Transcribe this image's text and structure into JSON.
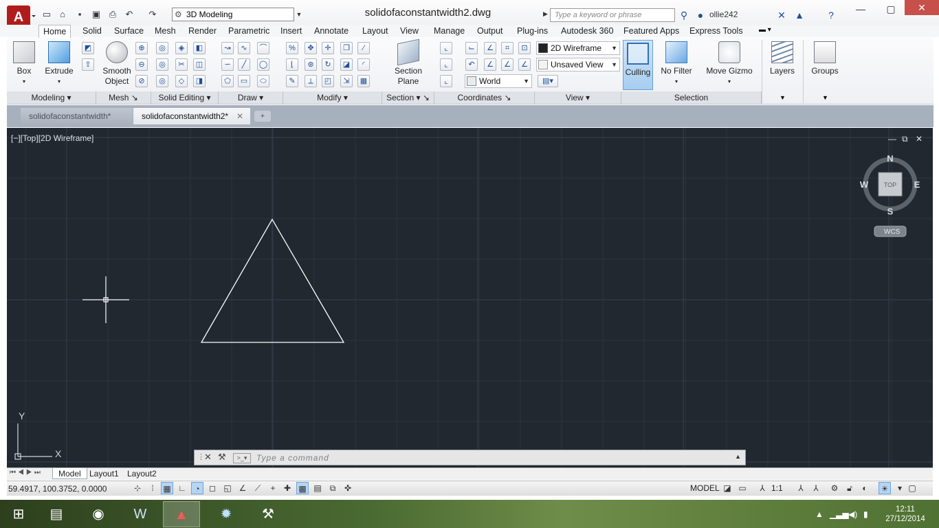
{
  "titlebar": {
    "workspace": "3D Modeling",
    "document_title": "solidofaconstantwidth2.dwg",
    "search_placeholder": "Type a keyword or phrase",
    "username": "ollie242"
  },
  "ribbon_tabs": [
    "Home",
    "Solid",
    "Surface",
    "Mesh",
    "Render",
    "Parametric",
    "Insert",
    "Annotate",
    "Layout",
    "View",
    "Manage",
    "Output",
    "Plug-ins",
    "Autodesk 360",
    "Featured Apps",
    "Express Tools"
  ],
  "active_tab": "Home",
  "panels": {
    "modeling": {
      "title": "Modeling",
      "box": "Box",
      "extrude": "Extrude"
    },
    "mesh": {
      "title": "Mesh",
      "smooth_object_1": "Smooth",
      "smooth_object_2": "Object"
    },
    "solid_editing": {
      "title": "Solid Editing"
    },
    "draw": {
      "title": "Draw"
    },
    "modify": {
      "title": "Modify"
    },
    "section": {
      "title": "Section",
      "section_plane_1": "Section",
      "section_plane_2": "Plane"
    },
    "coordinates": {
      "title": "Coordinates",
      "ucs": "World"
    },
    "view": {
      "title": "View",
      "visual_style": "2D Wireframe",
      "named_view": "Unsaved View"
    },
    "selection": {
      "title": "Selection",
      "culling": "Culling",
      "no_filter": "No Filter",
      "move_gizmo": "Move Gizmo"
    },
    "layers": {
      "label": "Layers"
    },
    "groups": {
      "label": "Groups"
    }
  },
  "doc_tabs": [
    "solidofaconstantwidth*",
    "solidofaconstantwidth2*"
  ],
  "viewport": {
    "label": "[−][Top][2D Wireframe]",
    "viewcube": {
      "n": "N",
      "s": "S",
      "e": "E",
      "w": "W",
      "face": "TOP",
      "wcs": "WCS"
    },
    "ucs_x": "X",
    "ucs_y": "Y"
  },
  "command_line": {
    "placeholder": "Type  a  command"
  },
  "layout_tabs": [
    "Model",
    "Layout1",
    "Layout2"
  ],
  "status": {
    "coordinates": "59.4917, 100.3752, 0.0000",
    "model": "MODEL",
    "scale": "1:1"
  },
  "taskbar": {
    "time": "12:11",
    "date": "27/12/2014",
    "apps": [
      "file-explorer",
      "chrome",
      "word",
      "autocad",
      "weather",
      "tools"
    ]
  },
  "colors": {
    "viewport_bg": "#212830",
    "accent": "#b01c1c"
  }
}
